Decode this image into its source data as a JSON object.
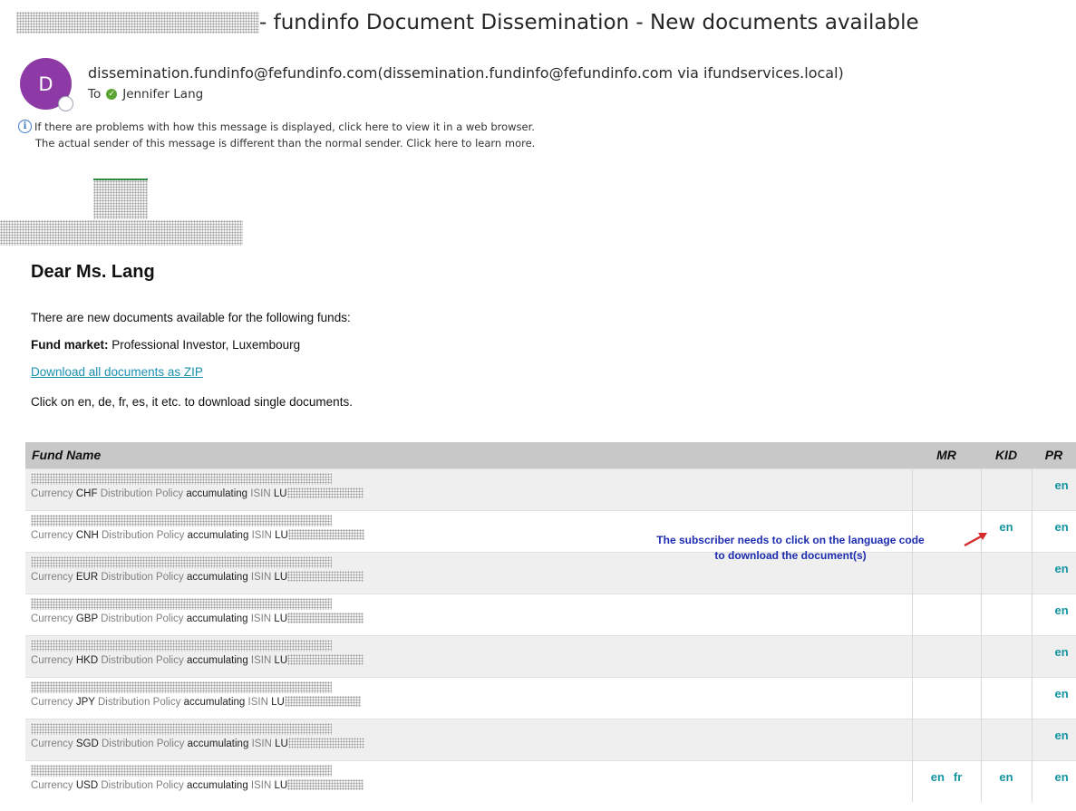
{
  "email": {
    "subject": "- fundinfo Document Dissemination - New documents available",
    "avatar_letter": "D",
    "sender": "dissemination.fundinfo@fefundinfo.com(dissemination.fundinfo@fefundinfo.com via ifundservices.local)",
    "to_label": "To",
    "recipient": "Jennifer Lang",
    "notice_1": "If there are problems with how this message is displayed, click here to view it in a web browser.",
    "notice_2": "The actual sender of this message is different than the normal sender. Click here to learn more."
  },
  "body": {
    "greeting": "Dear Ms. Lang",
    "intro": "There are new documents available for the following funds:",
    "fund_market_label": "Fund market:",
    "fund_market_value": "Professional Investor, Luxembourg",
    "zip_link": "Download all documents as ZIP",
    "instruction": "Click on en, de, fr, es, it etc. to download single documents."
  },
  "table": {
    "headers": {
      "fund_name": "Fund Name",
      "mr": "MR",
      "kid": "KID",
      "pr": "PR"
    },
    "labels": {
      "currency": "Currency",
      "distribution_policy": "Distribution Policy",
      "isin": "ISIN",
      "isin_prefix": "LU"
    },
    "rows": [
      {
        "currency": "CHF",
        "policy": "accumulating",
        "mr": [],
        "kid": [],
        "pr": [
          "en"
        ]
      },
      {
        "currency": "CNH",
        "policy": "accumulating",
        "mr": [],
        "kid": [
          "en"
        ],
        "pr": [
          "en"
        ]
      },
      {
        "currency": "EUR",
        "policy": "accumulating",
        "mr": [],
        "kid": [],
        "pr": [
          "en"
        ]
      },
      {
        "currency": "GBP",
        "policy": "accumulating",
        "mr": [],
        "kid": [],
        "pr": [
          "en"
        ]
      },
      {
        "currency": "HKD",
        "policy": "accumulating",
        "mr": [],
        "kid": [],
        "pr": [
          "en"
        ]
      },
      {
        "currency": "JPY",
        "policy": "accumulating",
        "mr": [],
        "kid": [],
        "pr": [
          "en"
        ]
      },
      {
        "currency": "SGD",
        "policy": "accumulating",
        "mr": [],
        "kid": [],
        "pr": [
          "en"
        ]
      },
      {
        "currency": "USD",
        "policy": "accumulating",
        "mr": [
          "en",
          "fr"
        ],
        "kid": [
          "en"
        ],
        "pr": [
          "en"
        ]
      }
    ]
  },
  "annotation": {
    "line_1": "The subscriber needs to click on the language code",
    "line_2": "to download the document(s)",
    "color": "#1c2cb0",
    "arrow_color": "#d42a2a"
  },
  "colors": {
    "avatar": "#8e3aa6",
    "link": "#1a90b0",
    "lang_link": "#1595a0",
    "header_bg": "#c8c8c8"
  }
}
